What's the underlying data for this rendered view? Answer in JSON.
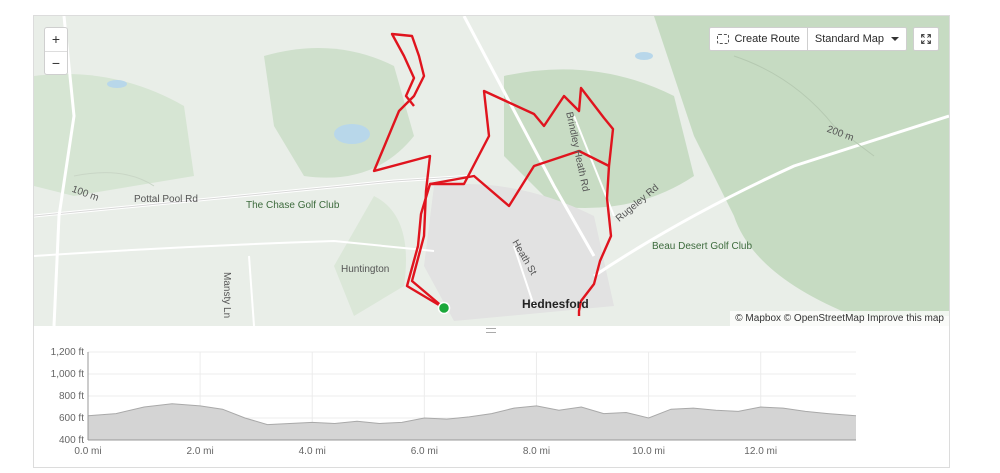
{
  "map": {
    "zoom_in": "+",
    "zoom_out": "−",
    "create_route_label": "Create Route",
    "map_style_label": "Standard Map",
    "fullscreen_icon": "fullscreen-icon",
    "attribution": "© Mapbox © OpenStreetMap Improve this map",
    "labels": {
      "pottal_pool_rd": "Pottal Pool Rd",
      "chase_golf": "The Chase Golf Club",
      "huntington": "Huntington",
      "mansty_ln": "Mansty Ln",
      "brindley": "Brindley Heath Rd",
      "rugeley": "Rugeley Rd",
      "beau_desert": "Beau Desert Golf Club",
      "heath_st": "Heath St",
      "hednesford": "Hednesford",
      "contour_100": "100 m",
      "contour_200": "200 m"
    },
    "colors": {
      "route": "#e0141e",
      "start": "#1aa83a",
      "water": "#b8d7ea",
      "forest": "#c9ddc6"
    }
  },
  "elevation": {
    "y_ticks": [
      "1,200 ft",
      "1,000 ft",
      "800 ft",
      "600 ft",
      "400 ft"
    ],
    "x_ticks": [
      "0.0 mi",
      "2.0 mi",
      "4.0 mi",
      "6.0 mi",
      "8.0 mi",
      "10.0 mi",
      "12.0 mi"
    ]
  },
  "chart_data": {
    "type": "area",
    "xlabel": "",
    "ylabel": "",
    "xlim": [
      0,
      13.7
    ],
    "ylim": [
      400,
      1200
    ],
    "x": [
      0,
      0.5,
      1.0,
      1.5,
      2.0,
      2.4,
      2.8,
      3.2,
      3.6,
      4.0,
      4.4,
      4.8,
      5.2,
      5.6,
      6.0,
      6.4,
      6.8,
      7.2,
      7.6,
      8.0,
      8.4,
      8.8,
      9.2,
      9.6,
      10.0,
      10.4,
      10.8,
      11.2,
      11.6,
      12.0,
      12.4,
      12.8,
      13.2,
      13.7
    ],
    "y": [
      620,
      640,
      700,
      730,
      710,
      680,
      600,
      540,
      550,
      560,
      550,
      570,
      550,
      560,
      600,
      590,
      610,
      640,
      690,
      710,
      670,
      700,
      640,
      650,
      600,
      680,
      690,
      670,
      660,
      700,
      690,
      660,
      640,
      620
    ]
  }
}
